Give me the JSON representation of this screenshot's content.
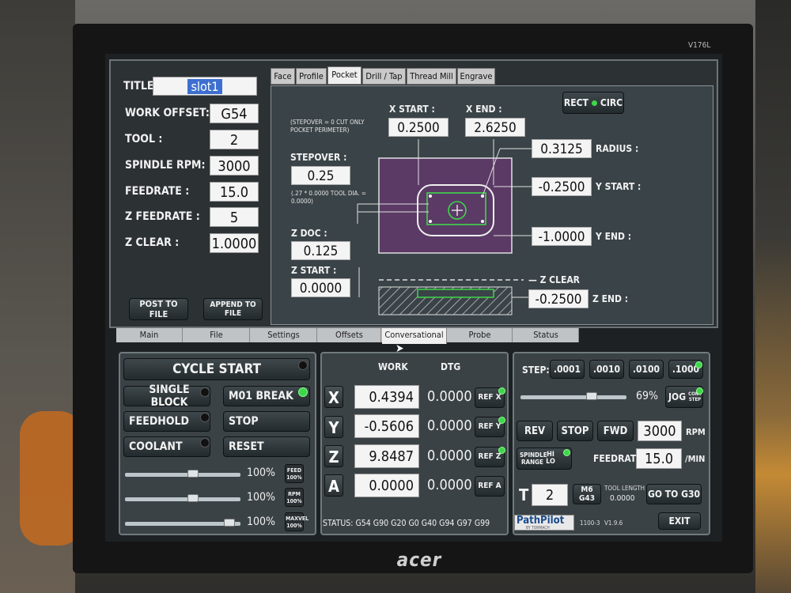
{
  "monitor": {
    "brand": "acer",
    "model": "V176L"
  },
  "conversational": {
    "title_label": "TITLE :",
    "title_value": "slot1",
    "fields": [
      {
        "label": "WORK OFFSET:",
        "value": "G54"
      },
      {
        "label": "TOOL :",
        "value": "2"
      },
      {
        "label": "SPINDLE RPM:",
        "value": "3000"
      },
      {
        "label": "FEEDRATE :",
        "value": "15.0"
      },
      {
        "label": "Z FEEDRATE :",
        "value": "5"
      },
      {
        "label": "Z CLEAR :",
        "value": "1.0000"
      }
    ],
    "post_to_file": "POST TO FILE",
    "append_to_file": "APPEND TO FILE",
    "tabs": [
      "Face",
      "Profile",
      "Pocket",
      "Drill / Tap",
      "Thread Mill",
      "Engrave"
    ],
    "active_tab": "Pocket",
    "rect_circ": {
      "rect": "RECT",
      "circ": "CIRC"
    },
    "diagram": {
      "x_start_label": "X START :",
      "x_start": "0.2500",
      "x_end_label": "X END :",
      "x_end": "2.6250",
      "radius": "0.3125",
      "radius_label": "RADIUS :",
      "y_start": "-0.2500",
      "y_start_label": "Y START :",
      "y_end": "-1.0000",
      "y_end_label": "Y END :",
      "note": "(STEPOVER = 0 CUT ONLY POCKET PERIMETER)",
      "stepover_label": "STEPOVER :",
      "stepover": "0.25",
      "stepover_note": "(.27 * 0.0000 TOOL DIA. = 0.0000)",
      "z_doc_label": "Z DOC :",
      "z_doc": "0.125",
      "z_start_label": "Z START :",
      "z_start": "0.0000",
      "z_clear_label": "Z CLEAR",
      "z_end": "-0.2500",
      "z_end_label": "Z END :"
    }
  },
  "main_tabs": [
    "Main",
    "File",
    "Settings",
    "Offsets",
    "Conversational",
    "Probe",
    "Status"
  ],
  "active_main_tab": "Conversational",
  "machine": {
    "cycle_start": "CYCLE START",
    "single_block": "SINGLE BLOCK",
    "m01_break": "M01 BREAK",
    "feedhold": "FEEDHOLD",
    "stop": "STOP",
    "coolant": "COOLANT",
    "reset": "RESET",
    "overrides": [
      {
        "value": "100%",
        "level": 0.6,
        "button": "FEED 100%"
      },
      {
        "value": "100%",
        "level": 0.6,
        "button": "RPM 100%"
      },
      {
        "value": "100%",
        "level": 0.95,
        "button": "MAXVEL 100%"
      }
    ]
  },
  "dro": {
    "work_header": "WORK",
    "dtg_header": "DTG",
    "axes": [
      {
        "axis": "X",
        "work": "0.4394",
        "dtg": "0.0000",
        "ref": "REF X"
      },
      {
        "axis": "Y",
        "work": "-0.5606",
        "dtg": "0.0000",
        "ref": "REF Y"
      },
      {
        "axis": "Z",
        "work": "9.8487",
        "dtg": "0.0000",
        "ref": "REF Z"
      },
      {
        "axis": "A",
        "work": "0.0000",
        "dtg": "0.0000",
        "ref": "REF A"
      }
    ],
    "status": "STATUS: G54 G90 G20 G0 G40 G94 G97 G99"
  },
  "spindle": {
    "step_label": "STEP:",
    "steps": [
      ".0001",
      ".0010",
      ".0100",
      ".1000"
    ],
    "jog_pct": "69%",
    "jog_level": 0.69,
    "jog_btn": "JOG",
    "cont_step": "CONT STEP",
    "rev": "REV",
    "stop": "STOP",
    "fwd": "FWD",
    "rpm_value": "3000",
    "rpm_unit": "RPM",
    "range_label": "SPINDLE RANGE",
    "hi": "HI",
    "lo": "LO",
    "feedrate_label": "FEEDRATE:",
    "feedrate": "15.0",
    "feedrate_unit": "/MIN",
    "t_label": "T",
    "tool": "2",
    "m6g43": "M6 G43",
    "tool_length_label": "TOOL LENGTH",
    "tool_length": "0.0000",
    "goto_g30": "GO TO G30",
    "exit": "EXIT",
    "logo": "PathPilot",
    "logo_sub": "BY TORMACH",
    "machine_model": "1100-3",
    "version": "V1.9.6"
  },
  "colors": {
    "accent_green": "#3ed64a",
    "field_bg": "#f4f4f4",
    "panel_bg": "#3b4246",
    "pocket_fill": "#5b3a66"
  }
}
